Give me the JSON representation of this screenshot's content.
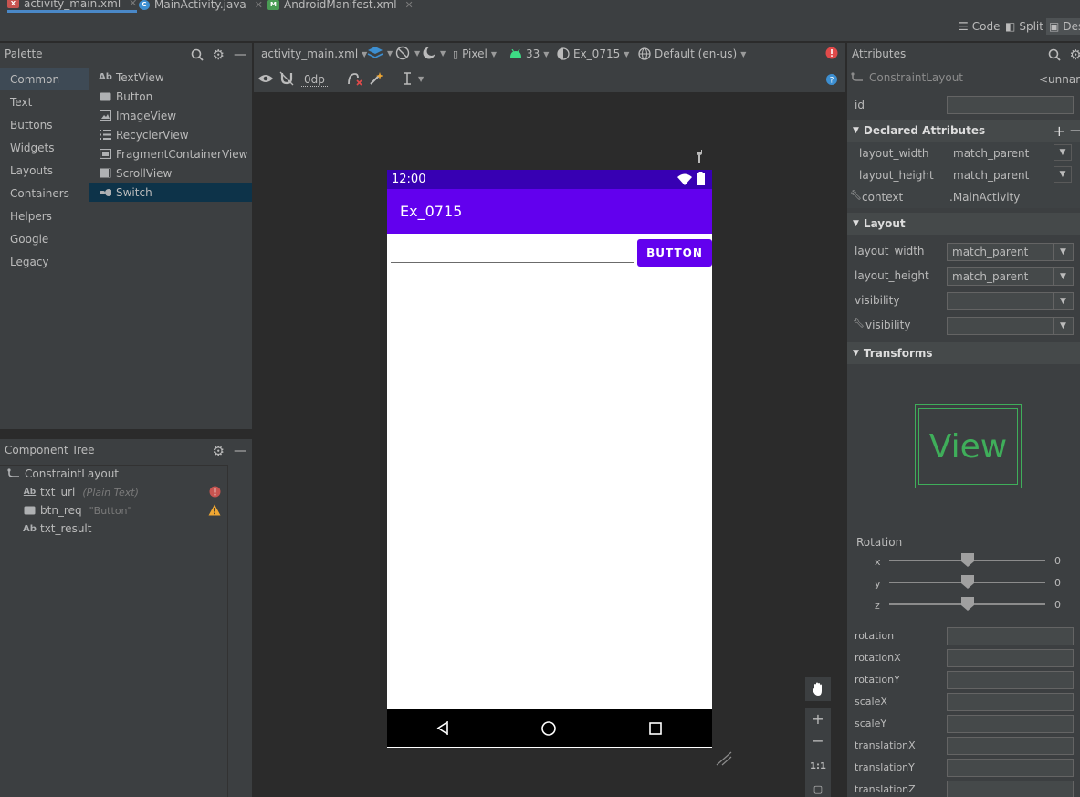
{
  "tabs": [
    {
      "label": "activity_main.xml",
      "icon": "xml-file-icon",
      "active": true
    },
    {
      "label": "MainActivity.java",
      "icon": "java-class-icon",
      "active": false
    },
    {
      "label": "AndroidManifest.xml",
      "icon": "manifest-file-icon",
      "active": false
    }
  ],
  "modes": {
    "code": "Code",
    "split": "Split",
    "design": "Des"
  },
  "palette": {
    "title": "Palette",
    "categories": [
      "Common",
      "Text",
      "Buttons",
      "Widgets",
      "Layouts",
      "Containers",
      "Helpers",
      "Google",
      "Legacy"
    ],
    "selected_category": "Common",
    "components": [
      {
        "label": "TextView",
        "icon": "Ab"
      },
      {
        "label": "Button",
        "icon": "button-icon"
      },
      {
        "label": "ImageView",
        "icon": "image-icon"
      },
      {
        "label": "RecyclerView",
        "icon": "list-icon"
      },
      {
        "label": "FragmentContainerView",
        "icon": "fragment-icon"
      },
      {
        "label": "ScrollView",
        "icon": "scrollview-icon"
      },
      {
        "label": "Switch",
        "icon": "switch-icon"
      }
    ],
    "selected_component": "Switch"
  },
  "tree": {
    "title": "Component Tree",
    "root": "ConstraintLayout",
    "items": [
      {
        "name": "txt_url",
        "hint": "(Plain Text)",
        "status": "error"
      },
      {
        "name": "btn_req",
        "hint": "\"Button\"",
        "status": "warning"
      },
      {
        "name": "txt_result",
        "hint": "",
        "status": ""
      }
    ]
  },
  "toolbar": {
    "file": "activity_main.xml",
    "margin": "0dp",
    "device": "Pixel",
    "api": "33",
    "theme": "Ex_0715",
    "locale": "Default (en-us)"
  },
  "phone": {
    "time": "12:00",
    "app_title": "Ex_0715",
    "button_label": "BUTTON",
    "colors": {
      "status": "#3700b3",
      "appbar": "#6200ee"
    }
  },
  "zoom": {
    "ratio": "1:1"
  },
  "attributes": {
    "title": "Attributes",
    "component": "ConstraintLayout",
    "component_id": "<unnam",
    "id_label": "id",
    "declared_title": "Declared Attributes",
    "declared": [
      {
        "name": "layout_width",
        "value": "match_parent"
      },
      {
        "name": "layout_height",
        "value": "match_parent"
      }
    ],
    "context_label": "context",
    "context_value": ".MainActivity",
    "layout_title": "Layout",
    "layout_rows": [
      {
        "name": "layout_width",
        "value": "match_parent"
      },
      {
        "name": "layout_height",
        "value": "match_parent"
      },
      {
        "name": "visibility",
        "value": ""
      },
      {
        "name": "visibility",
        "value": ""
      }
    ],
    "transforms_title": "Transforms",
    "view_label": "View",
    "rotation_title": "Rotation",
    "rotation_axes": [
      {
        "axis": "x",
        "value": "0"
      },
      {
        "axis": "y",
        "value": "0"
      },
      {
        "axis": "z",
        "value": "0"
      }
    ],
    "transform_fields": [
      "rotation",
      "rotationX",
      "rotationY",
      "scaleX",
      "scaleY",
      "translationX",
      "translationY",
      "translationZ"
    ]
  }
}
